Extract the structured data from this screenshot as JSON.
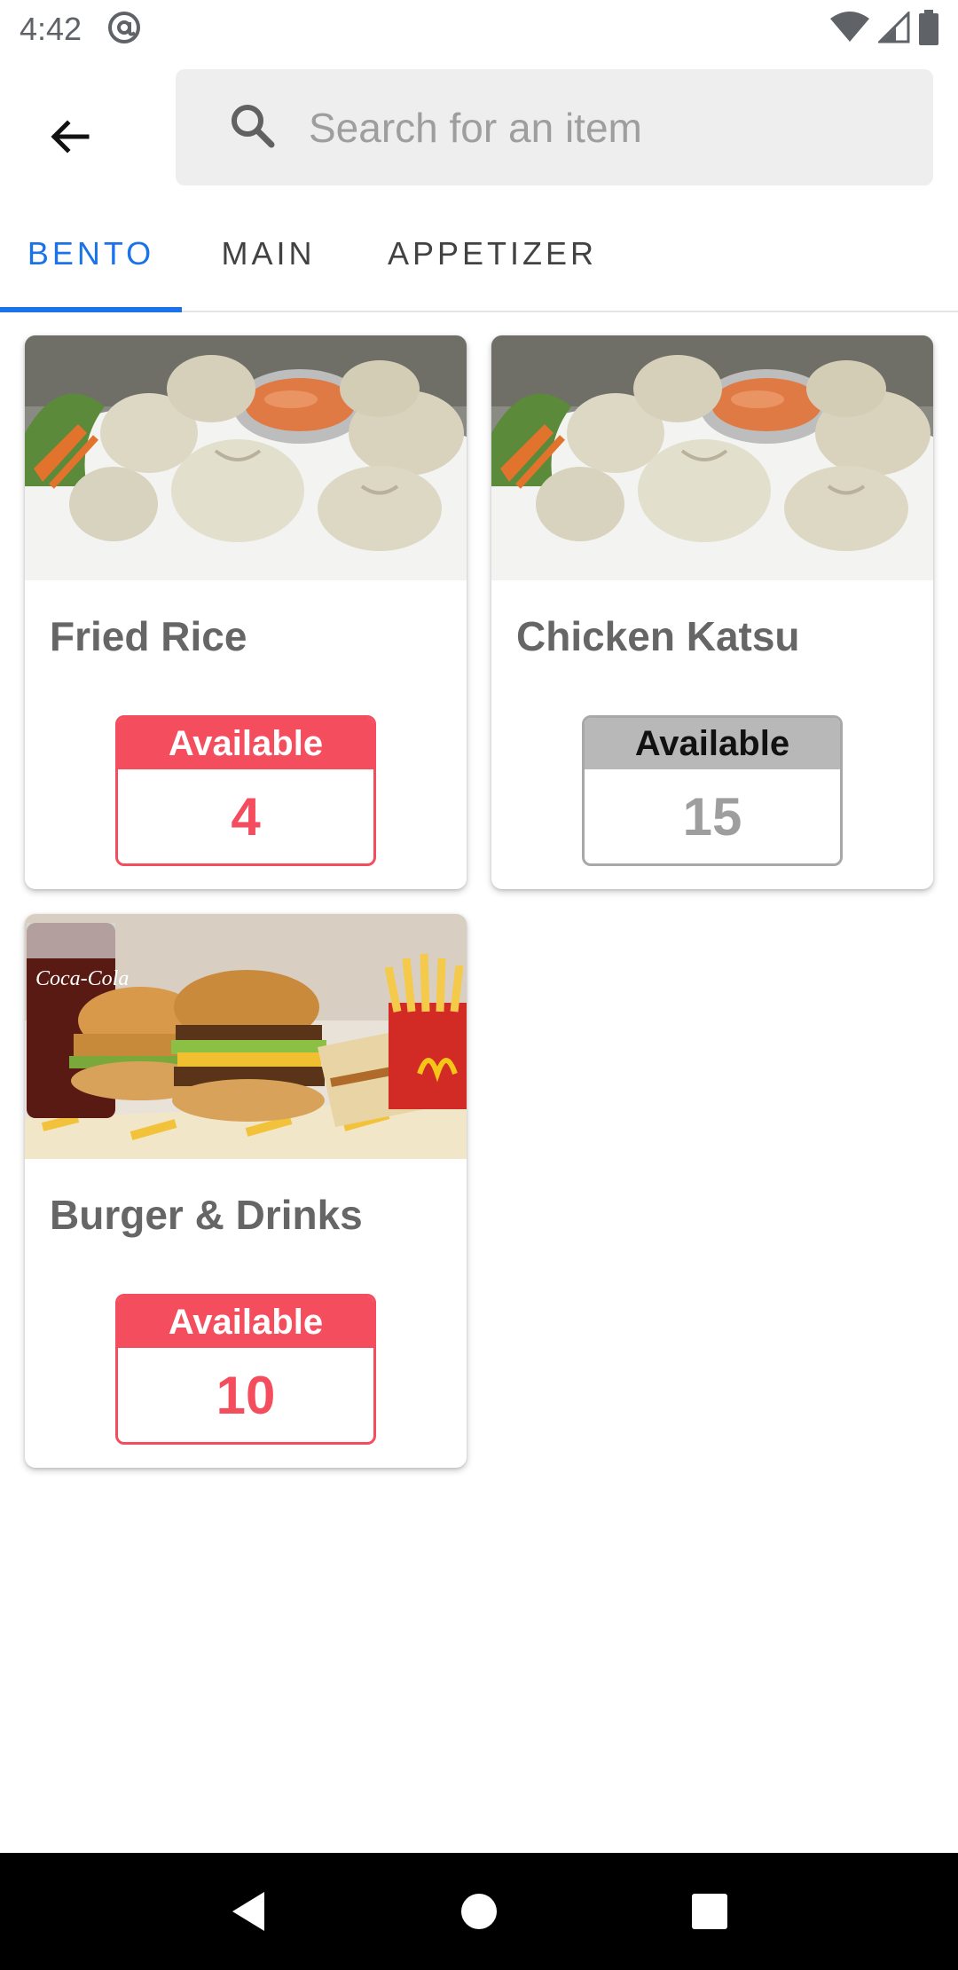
{
  "status_bar": {
    "time": "4:42",
    "icons": [
      "at-sign-icon",
      "wifi-icon",
      "cell-signal-icon",
      "battery-icon"
    ]
  },
  "search": {
    "placeholder": "Search for an item",
    "value": ""
  },
  "tabs": [
    {
      "label": "BENTO",
      "active": true
    },
    {
      "label": "MAIN",
      "active": false
    },
    {
      "label": "APPETIZER",
      "active": false
    }
  ],
  "items": [
    {
      "name": "Fried Rice",
      "availability_label": "Available",
      "count": "4",
      "style": "red",
      "image": "dumplings-image"
    },
    {
      "name": "Chicken Katsu",
      "availability_label": "Available",
      "count": "15",
      "style": "grey",
      "image": "dumplings-image"
    },
    {
      "name": "Burger & Drinks",
      "availability_label": "Available",
      "count": "10",
      "style": "red",
      "image": "burger-meal-image"
    }
  ],
  "colors": {
    "accent": "#1a73e8",
    "available_red": "#f44d5e",
    "available_grey": "#b8b8b8",
    "count_grey": "#9e9e9e",
    "title_grey": "#666666"
  },
  "nav_bar": {
    "buttons": [
      "back-triangle-icon",
      "home-circle-icon",
      "recents-square-icon"
    ]
  }
}
